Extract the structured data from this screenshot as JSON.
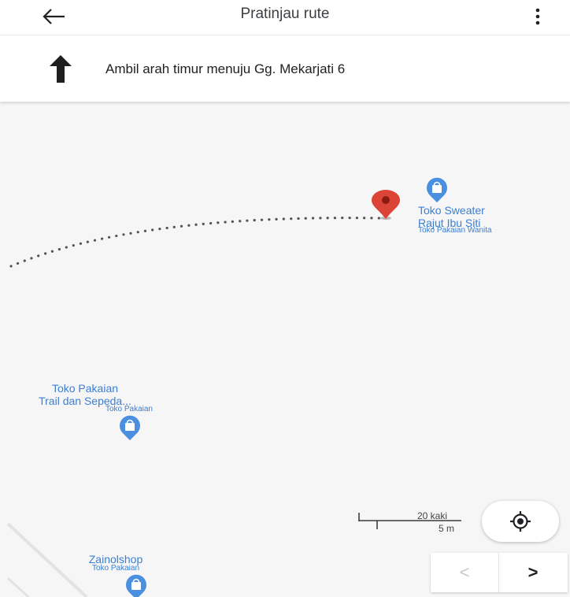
{
  "header": {
    "title": "Pratinjau rute",
    "back_icon": "arrow-left-icon",
    "menu_icon": "more-vert-icon"
  },
  "instruction": {
    "icon": "arrow-up-icon",
    "text": "Ambil arah timur menuju Gg. Mekarjati 6"
  },
  "map": {
    "pois": [
      {
        "name_line1": "Toko Sweater",
        "name_line2": "Rajut Ibu Siti",
        "category": "Toko Pakaian Wanita",
        "icon": "shopping-bag-icon"
      },
      {
        "name_line1": "Toko Pakaian",
        "name_line2": "Trail dan Sepeda...",
        "category": "Toko Pakaian",
        "icon": "shopping-bag-icon"
      },
      {
        "name_line1": "Zainolshop",
        "category": "Toko Pakaian",
        "icon": "shopping-bag-icon"
      }
    ],
    "destination_icon": "red-location-pin-icon",
    "scale": {
      "imperial": "20 kaki",
      "metric": "5 m"
    },
    "locate_icon": "my-location-icon",
    "nav": {
      "prev": "<",
      "next": ">"
    }
  },
  "colors": {
    "poi_blue": "#3b7fd1",
    "pin_red": "#db4437",
    "route_dots": "#555555",
    "map_background": "#f6f6f6"
  }
}
